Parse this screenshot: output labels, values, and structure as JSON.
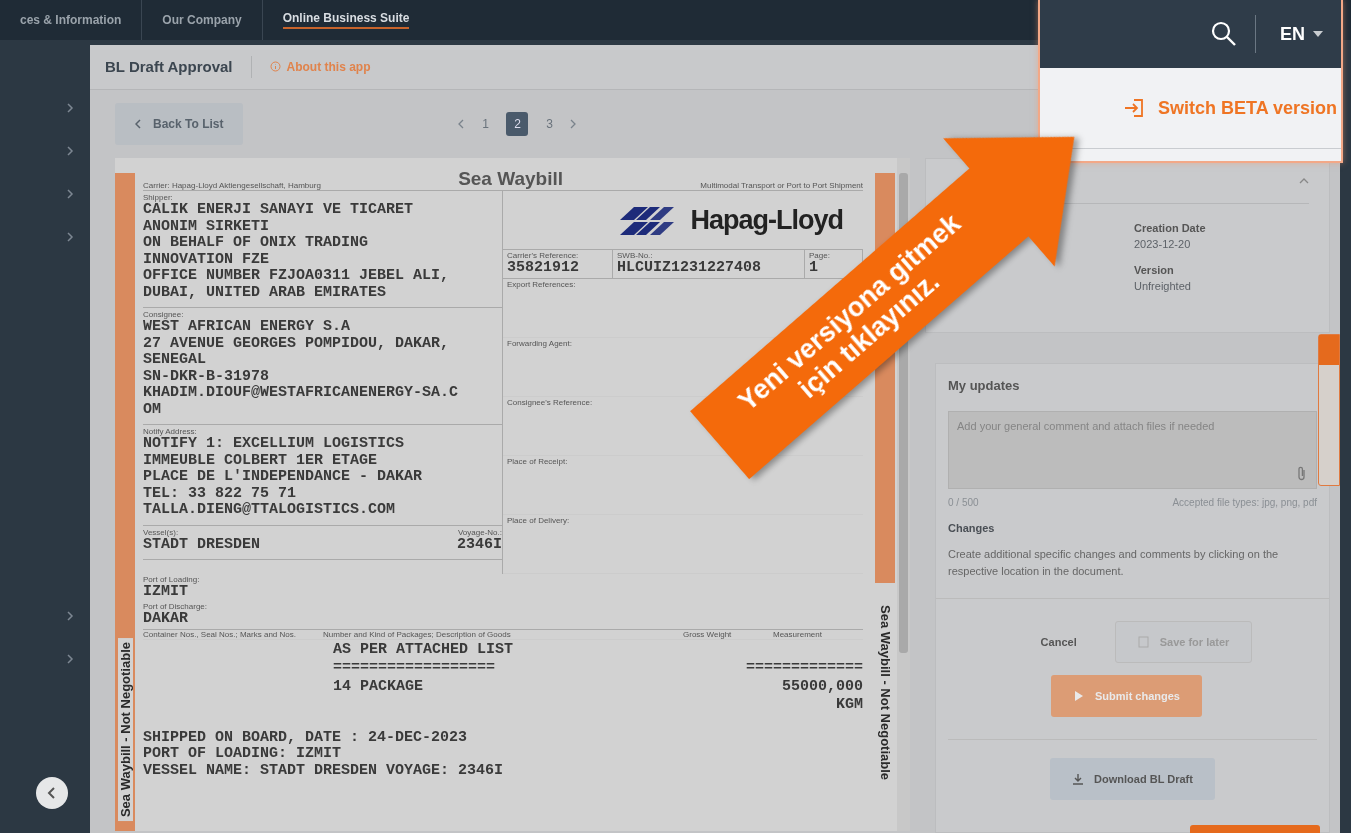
{
  "top_nav": {
    "links": [
      {
        "label": "ces & Information",
        "selected": false
      },
      {
        "label": "Our Company",
        "selected": false
      },
      {
        "label": "Online Business Suite",
        "selected": true
      }
    ]
  },
  "header_menu": {
    "language": "EN",
    "menu_items": [
      {
        "label": "Switch BETA version"
      }
    ]
  },
  "app_header": {
    "title": "BL Draft Approval",
    "about_link": "About this app"
  },
  "toolbar": {
    "back_button": "Back To List",
    "pages": [
      {
        "label": "1",
        "selected": false
      },
      {
        "label": "2",
        "selected": true
      },
      {
        "label": "3",
        "selected": false
      }
    ]
  },
  "document": {
    "carrier": "Carrier: Hapag-Lloyd Aktiengesellschaft, Hamburg",
    "title": "Sea Waybill",
    "subtitle": "Multimodal Transport or Port to Port Shipment",
    "logo_text": "Hapag-Lloyd",
    "side_labels": [
      "Sea Waybill - Not Negotiable",
      "Sea Waybill - Not Negotiable"
    ],
    "parties": [
      {
        "label": "Shipper:",
        "lines": [
          "CALIK ENERJI SANAYI VE TICARET",
          "ANONIM SIRKETI",
          "ON BEHALF OF ONIX TRADING",
          "INNOVATION FZE",
          "OFFICE NUMBER FZJOA0311 JEBEL ALI,",
          "DUBAI, UNITED ARAB EMIRATES"
        ]
      },
      {
        "label": "Consignee:",
        "lines": [
          "WEST AFRICAN ENERGY S.A",
          "27 AVENUE GEORGES POMPIDOU, DAKAR,",
          "SENEGAL",
          "SN-DKR-B-31978",
          "KHADIM.DIOUF@WESTAFRICANENERGY-SA.C",
          "OM"
        ]
      },
      {
        "label": "Notify Address:",
        "lines": [
          "NOTIFY 1: EXCELLIUM LOGISTICS",
          "IMMEUBLE COLBERT 1ER ETAGE",
          "PLACE DE L'INDEPENDANCE - DAKAR",
          "TEL: 33 822 75 71",
          "TALLA.DIENG@TTALOGISTICS.COM"
        ]
      }
    ],
    "vessel": {
      "label": "Vessel(s):",
      "value": "STADT DRESDEN"
    },
    "voyage": {
      "label": "Voyage-No.:",
      "value": "2346I"
    },
    "references": [
      {
        "label": "Carrier's Reference:",
        "value": "35821912"
      },
      {
        "label": "SWB-No.:",
        "value": "HLCUIZ1231227408"
      },
      {
        "label": "Page:",
        "value": "1"
      }
    ],
    "right_fields": [
      "Export References:",
      "Forwarding Agent:",
      "Consignee's Reference:",
      "Place of Receipt:",
      "Place of Delivery:"
    ],
    "ports": [
      {
        "label": "Port of Loading:",
        "value": "IZMIT"
      },
      {
        "label": "Port of Discharge:",
        "value": "DAKAR"
      }
    ],
    "goods_columns": [
      "Container Nos., Seal Nos.; Marks and Nos.",
      "Number and Kind of Packages; Description of Goods",
      "Gross Weight",
      "Measurement"
    ],
    "goods": [
      {
        "description": "AS PER ATTACHED LIST"
      },
      {
        "description": "==================",
        "weight": "============="
      },
      {
        "description": "14 PACKAGE",
        "weight": "55000,000"
      },
      {
        "weight": "KGM"
      }
    ],
    "remarks": [
      "SHIPPED ON BOARD, DATE : 24-DEC-2023",
      "PORT OF LOADING: IZMIT",
      "VESSEL NAME: STADT DRESDEN VOYAGE: 2346I"
    ]
  },
  "details": {
    "fields": [
      {
        "label": "Creation Date",
        "value": "2023-12-20"
      },
      {
        "label": "Version",
        "value": "Unfreighted"
      }
    ]
  },
  "my_updates": {
    "title": "My updates",
    "comment_placeholder": "Add your general comment and attach files if needed",
    "counter": "0 / 500",
    "file_types": "Accepted file types: jpg, png, pdf",
    "changes_title": "Changes",
    "changes_text": "Create additional specific changes and comments by clicking on the respective location in the document.",
    "buttons": [
      {
        "label": "Cancel",
        "kind": "link",
        "disabled": false
      },
      {
        "label": "Save for later",
        "kind": "secondary",
        "disabled": true
      },
      {
        "label": "Submit changes",
        "kind": "primary",
        "disabled": true
      },
      {
        "label": "Download BL Draft",
        "kind": "download",
        "disabled": false
      }
    ]
  },
  "callout": {
    "lines": [
      "Yeni versiyona gitmek",
      "için tıklayınız."
    ]
  }
}
